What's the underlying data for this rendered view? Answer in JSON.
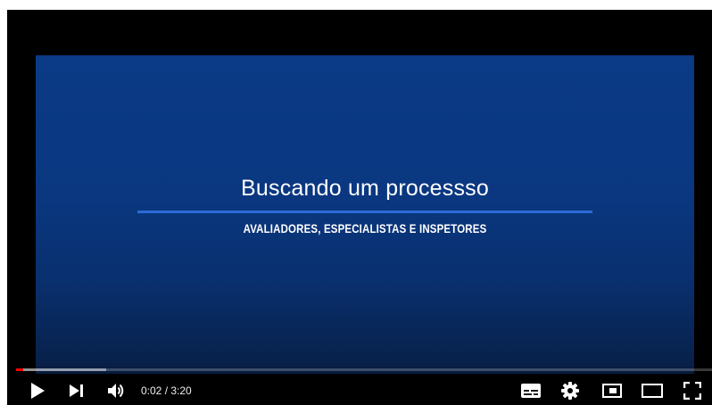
{
  "slide": {
    "title": "Buscando um processso",
    "subtitle": "AVALIADORES, ESPECIALISTAS E INSPETORES"
  },
  "player": {
    "current_time": "0:02",
    "separator": " / ",
    "duration": "3:20",
    "progress_played_fraction": 0.01,
    "progress_loaded_fraction": 0.13,
    "controls": {
      "left": [
        "play-icon",
        "next-icon",
        "volume-icon"
      ],
      "right": [
        "subtitles-icon",
        "settings-gear-icon",
        "miniplayer-icon",
        "theater-mode-icon",
        "fullscreen-icon"
      ]
    }
  },
  "colors": {
    "slide_blue": "#0b3a86",
    "rule_blue": "#2b6bd6",
    "progress_red": "#ff0000",
    "player_black": "#000000"
  }
}
